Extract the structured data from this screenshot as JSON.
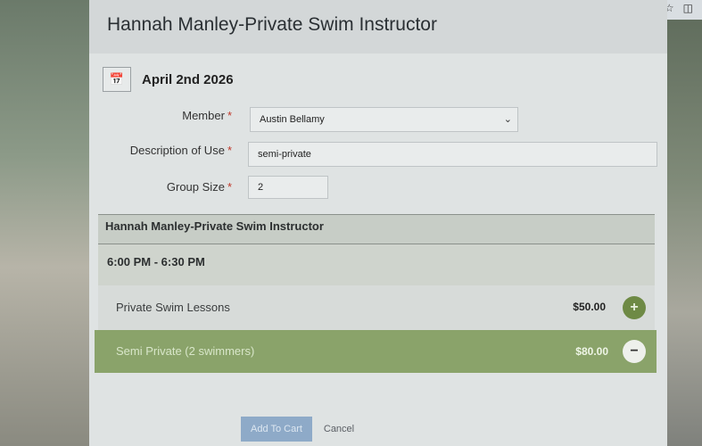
{
  "modal": {
    "title": "Hannah Manley-Private Swim Instructor"
  },
  "date": {
    "text": "April 2nd 2026",
    "calendar_icon": "calendar-icon"
  },
  "form": {
    "member_label": "Member",
    "member_value": "Austin Bellamy",
    "description_label": "Description of Use",
    "description_value": "semi-private",
    "group_size_label": "Group Size",
    "group_size_value": "2",
    "required_mark": "*"
  },
  "instructor_bar": {
    "name": "Hannah Manley-Private Swim Instructor"
  },
  "time_slot": {
    "text": "6:00 PM - 6:30 PM"
  },
  "lessons": [
    {
      "name": "Private Swim Lessons",
      "price": "$50.00",
      "action": "+"
    },
    {
      "name": "Semi Private (2 swimmers)",
      "price": "$80.00",
      "action": "−"
    }
  ],
  "footer": {
    "add_to_cart": "Add To Cart",
    "cancel": "Cancel"
  },
  "colors": {
    "selected_row": "#8aa36a",
    "add_button": "#6e8a45",
    "primary_button": "#8eaac8",
    "required": "#c0392b"
  }
}
